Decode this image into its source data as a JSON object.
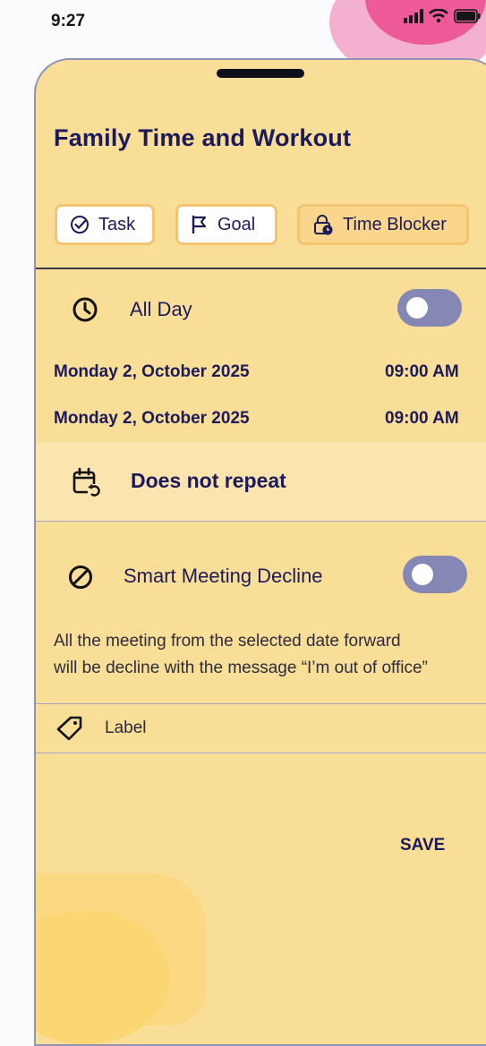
{
  "status_bar": {
    "time": "9:27",
    "icons": [
      "signal-icon",
      "wifi-icon",
      "battery-icon"
    ]
  },
  "sheet": {
    "title": "Family Time and Workout",
    "type_tabs": [
      {
        "label": "Task",
        "icon": "check-circle-icon",
        "selected": true
      },
      {
        "label": "Goal",
        "icon": "flag-icon",
        "selected": false
      },
      {
        "label": "Time Blocker",
        "icon": "lock-clock-icon",
        "selected": false
      }
    ],
    "all_day": {
      "label": "All Day",
      "icon": "clock-icon",
      "enabled": false
    },
    "start": {
      "date": "Monday 2, October 2025",
      "time": "09:00 AM"
    },
    "end": {
      "date": "Monday 2, October 2025",
      "time": "09:00 AM"
    },
    "repeat": {
      "label": "Does not repeat",
      "icon": "calendar-repeat-icon"
    },
    "smart_decline": {
      "label": "Smart Meeting Decline",
      "icon": "block-icon",
      "enabled": false,
      "description_line1": "All the meeting from the selected date forward",
      "description_line2": "will be decline with the message “I’m out of office”"
    },
    "label_field": {
      "label": "Label",
      "icon": "tag-icon"
    },
    "save_label": "SAVE"
  },
  "colors": {
    "sheet_bg": "#f9de98",
    "accent_navy": "#1d1a5a",
    "toggle_off": "#8587b5",
    "chip_border": "#f5c470",
    "pink": "#ee5a98"
  }
}
